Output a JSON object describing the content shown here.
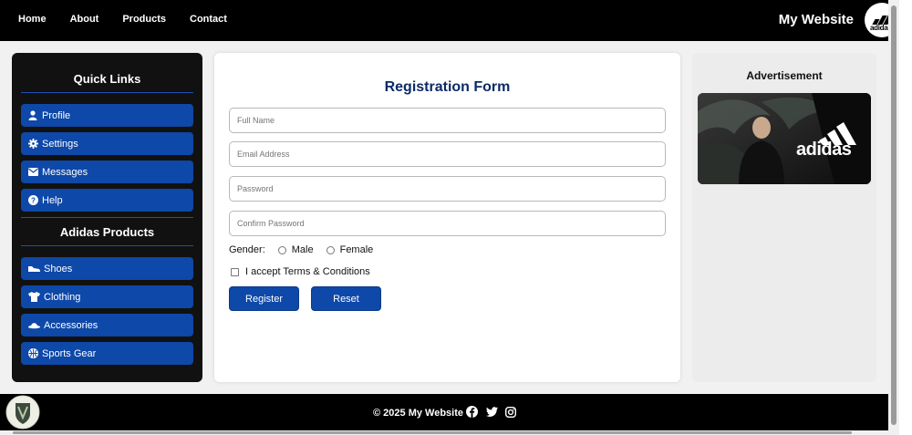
{
  "nav": {
    "items": [
      {
        "label": "Home"
      },
      {
        "label": "About"
      },
      {
        "label": "Products"
      },
      {
        "label": "Contact"
      }
    ],
    "brand": "My Website",
    "logo_text": "adidas"
  },
  "sidebar": {
    "quick_links_title": "Quick Links",
    "quick_links": [
      {
        "label": "Profile",
        "icon": "user-icon"
      },
      {
        "label": "Settings",
        "icon": "gear-icon"
      },
      {
        "label": "Messages",
        "icon": "envelope-icon"
      },
      {
        "label": "Help",
        "icon": "question-circle-icon"
      }
    ],
    "products_title": "Adidas Products",
    "products": [
      {
        "label": "Shoes",
        "icon": "shoe-icon"
      },
      {
        "label": "Clothing",
        "icon": "shirt-icon"
      },
      {
        "label": "Accessories",
        "icon": "hat-icon"
      },
      {
        "label": "Sports Gear",
        "icon": "ball-icon"
      }
    ]
  },
  "form": {
    "title": "Registration Form",
    "fields": {
      "full_name": {
        "placeholder": "Full Name",
        "value": ""
      },
      "email": {
        "placeholder": "Email Address",
        "value": ""
      },
      "password": {
        "placeholder": "Password",
        "value": ""
      },
      "confirm_password": {
        "placeholder": "Confirm Password",
        "value": ""
      }
    },
    "gender_label": "Gender:",
    "gender_options": [
      "Male",
      "Female"
    ],
    "terms_label": "I accept Terms & Conditions",
    "register_label": "Register",
    "reset_label": "Reset"
  },
  "ad": {
    "title": "Advertisement",
    "image_brand_text": "adidas"
  },
  "footer": {
    "text": "© 2025 My Website",
    "social_icons": [
      "facebook-icon",
      "twitter-icon",
      "instagram-icon"
    ]
  },
  "colors": {
    "primary": "#0e48a8",
    "title_blue": "#0c2b66",
    "dark": "#111111",
    "band": "#f1f1f1"
  }
}
